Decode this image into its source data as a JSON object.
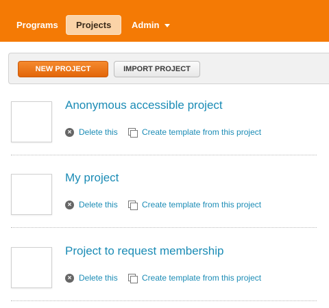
{
  "nav": {
    "programs": "Programs",
    "projects": "Projects",
    "admin": "Admin"
  },
  "toolbar": {
    "new_project": "NEW PROJECT",
    "import_project": "IMPORT PROJECT"
  },
  "projects": [
    {
      "title": "Anonymous accessible project",
      "delete_label": "Delete this",
      "template_label": "Create template from this project"
    },
    {
      "title": "My project",
      "delete_label": "Delete this",
      "template_label": "Create template from this project"
    },
    {
      "title": "Project to request membership",
      "delete_label": "Delete this",
      "template_label": "Create template from this project"
    }
  ],
  "colors": {
    "accent": "#f47a05",
    "link": "#1a8bb5"
  }
}
